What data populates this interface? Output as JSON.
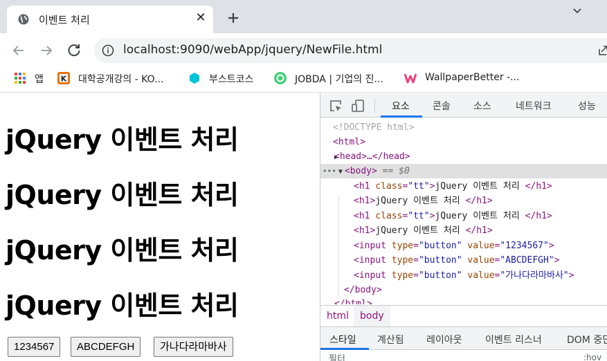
{
  "tab": {
    "title": "이벤트 처리",
    "close": "✕"
  },
  "toolbar": {
    "url": "localhost:9090/webApp/jquery/NewFile.html"
  },
  "bookmarks": [
    {
      "label": "앱",
      "icon": "apps-grid-icon"
    },
    {
      "label": "대학공개강의 - KO...",
      "icon": "kocw-icon"
    },
    {
      "label": "부스트코스",
      "icon": "boostcourse-icon"
    },
    {
      "label": "JOBDA | 기업의 진...",
      "icon": "jobda-icon"
    },
    {
      "label": "WallpaperBetter -...",
      "icon": "wallpaperbetter-icon"
    }
  ],
  "page": {
    "headings": [
      "jQuery 이벤트 처리",
      "jQuery 이벤트 처리",
      "jQuery 이벤트 처리",
      "jQuery 이벤트 처리"
    ],
    "buttons": [
      "1234567",
      "ABCDEFGH",
      "가나다라마바사"
    ]
  },
  "devtools": {
    "tabs": [
      "요소",
      "콘솔",
      "소스",
      "네트워크",
      "성능"
    ],
    "dom": {
      "doctype": "<!DOCTYPE html>",
      "html_open": "<html>",
      "head": "<head>…</head>",
      "body_open": "<body>",
      "body_marker": " == $0",
      "h1_tt_1": {
        "tag": "h1",
        "attr": "class",
        "value": "\"tt\"",
        "text": "jQuery 이벤트 처리 "
      },
      "h1_1": {
        "tag": "h1",
        "text": "jQuery 이벤트 처리 "
      },
      "h1_tt_2": {
        "tag": "h1",
        "attr": "class",
        "value": "\"tt\"",
        "text": "jQuery 이벤트 처리 "
      },
      "h1_2": {
        "tag": "h1",
        "text": "jQuery 이벤트 처리 "
      },
      "inputs": [
        {
          "type": "\"button\"",
          "value": "\"1234567\""
        },
        {
          "type": "\"button\"",
          "value": "\"ABCDEFGH\""
        },
        {
          "type": "\"button\"",
          "value": "\"가나다라마바사\""
        }
      ],
      "body_close": "</body>",
      "html_close": "</html>"
    },
    "breadcrumbs": [
      "html",
      "body"
    ],
    "styles_tabs": [
      "스타일",
      "계산됨",
      "레이아웃",
      "이벤트 리스너",
      "DOM 중단"
    ],
    "filter_placeholder": "필터",
    "filter_right": ":hov"
  },
  "colors": {
    "tag": "#881280",
    "attr": "#994500",
    "value": "#1a1aa6",
    "accent": "#1a73e8"
  }
}
